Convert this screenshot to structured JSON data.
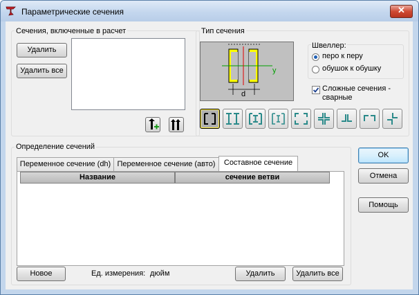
{
  "window": {
    "title": "Параметрические сечения",
    "close": "✕"
  },
  "included": {
    "group_label": "Сечения, включенные в расчет",
    "delete_btn": "Удалить",
    "delete_all_btn": "Удалить все"
  },
  "section_type": {
    "group_label": "Тип сечения",
    "preview_labels": {
      "y": "y",
      "d": "d"
    },
    "channel": {
      "label": "Швеллер:",
      "options": [
        "перо к перу",
        "обушок к обушку"
      ],
      "selected": "перо к перу"
    },
    "complex_checkbox": {
      "line1": "Сложные сечения -",
      "line2": "сварные",
      "checked": true
    },
    "shapes": [
      "double-channel-icon",
      "double-i-beam-icon",
      "i-in-channels-icon",
      "i-beam-outline-icon",
      "double-channel-outward-icon",
      "cross-angles-icon",
      "double-angle-icon",
      "angle-pair-icon",
      "diagonal-angles-icon"
    ],
    "selected_shape": 0
  },
  "definition": {
    "group_label": "Определение сечений",
    "tabs": [
      "Переменное сечение (dh)",
      "Переменное сечение (авто)",
      "Составное сечение"
    ],
    "active_tab": 2,
    "columns": [
      "Название",
      "сечение ветви"
    ]
  },
  "footer": {
    "new_btn": "Новое",
    "units_label": "Ед. измерения:",
    "units_value": "дюйм",
    "delete_btn": "Удалить",
    "delete_all_btn": "Удалить все"
  },
  "side": {
    "ok": "OK",
    "cancel": "Отмена",
    "help": "Помощь"
  },
  "colors": {
    "title_bar": "#c4d7ee",
    "close": "#cf4a34",
    "ok_border": "#3c7fb1",
    "preview_bg": "#c0c0c0",
    "channel_fill": "#ffff00",
    "selected_radio": "#1f5fb4"
  }
}
